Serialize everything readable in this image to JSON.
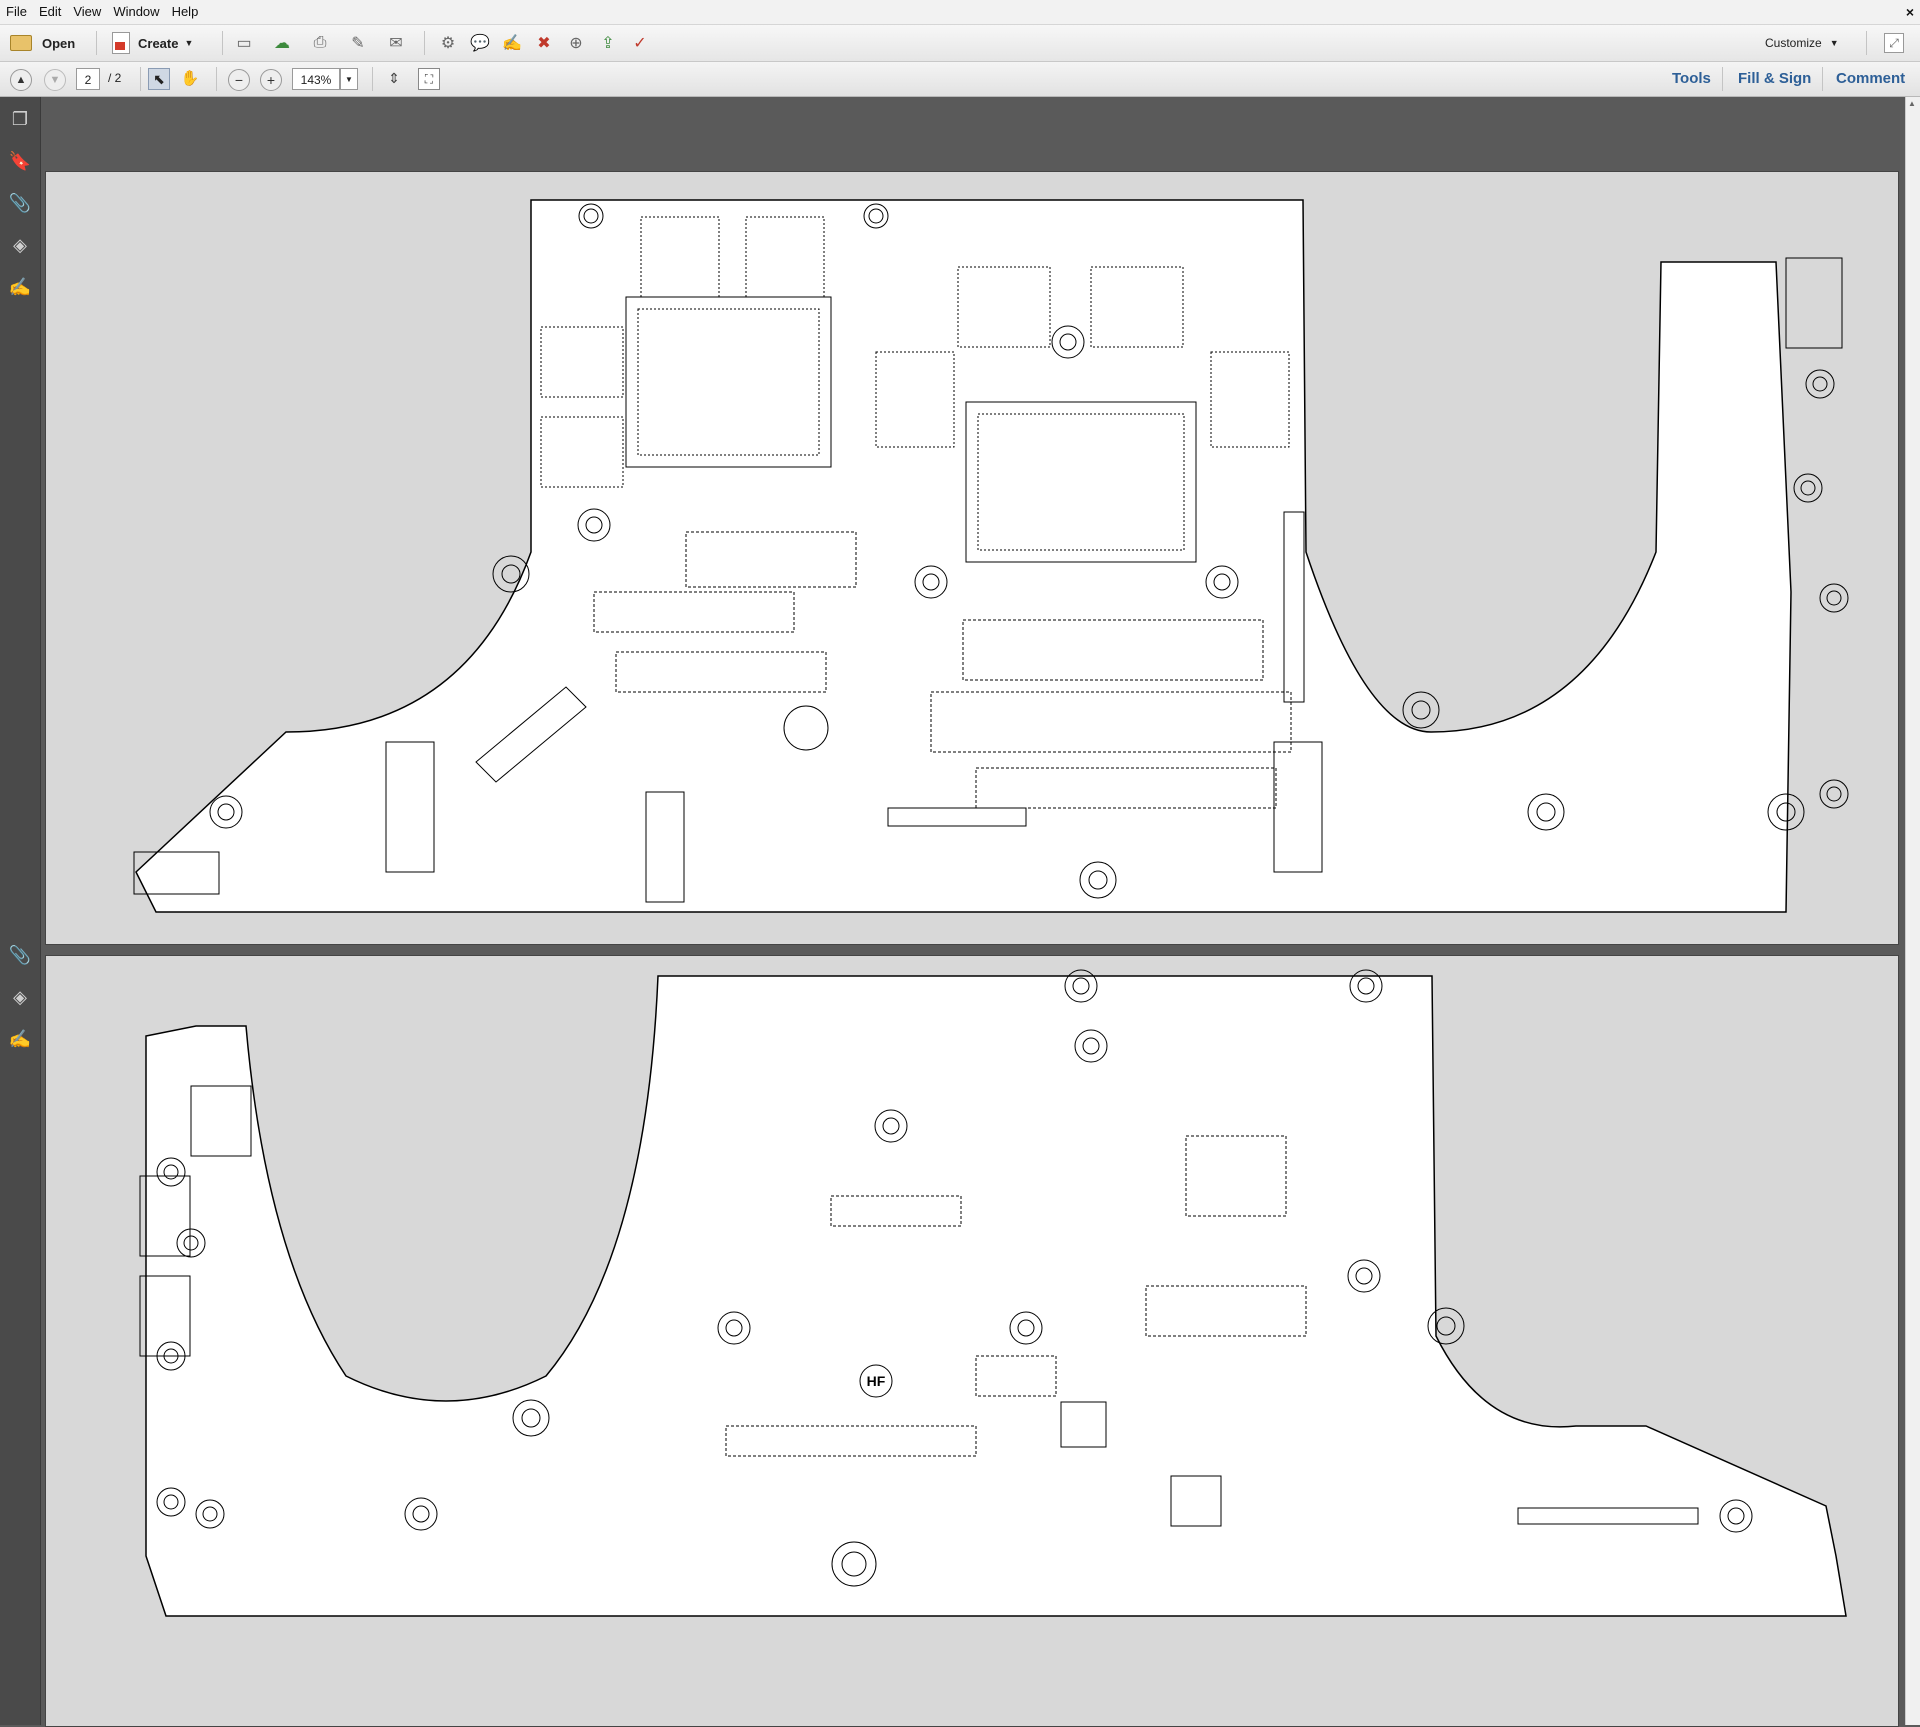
{
  "menu": {
    "items": [
      "File",
      "Edit",
      "View",
      "Window",
      "Help"
    ],
    "close_glyph": "×"
  },
  "toolbar": {
    "open_label": "Open",
    "create_label": "Create",
    "customize_label": "Customize",
    "icons": [
      "save-icon",
      "upload-icon",
      "print-icon",
      "edit-icon",
      "email-icon",
      "settings-icon",
      "comment-icon",
      "sign-icon",
      "delete-icon",
      "attach-icon",
      "export-icon",
      "review-icon"
    ]
  },
  "nav": {
    "current_page": "2",
    "page_total": "/ 2",
    "zoom": "143%",
    "tools_label": "Tools",
    "fill_sign_label": "Fill & Sign",
    "comment_label": "Comment"
  },
  "document": {
    "top_view_stamp": "",
    "bottom_view_stamp": "HF"
  },
  "colors": {
    "accent": "#2d5f97",
    "page_bg": "#d8d8d8",
    "board_fill": "#ffffff",
    "board_stroke": "#000000"
  }
}
